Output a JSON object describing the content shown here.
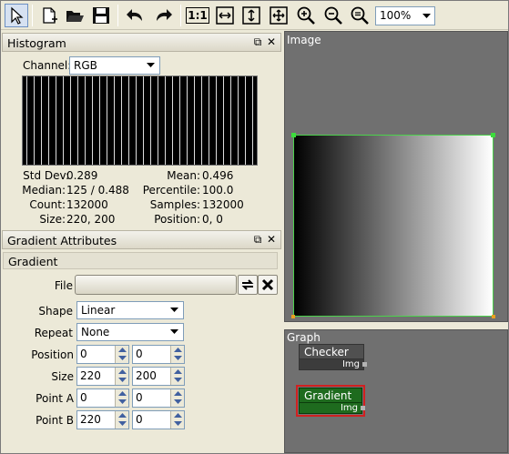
{
  "toolbar": {
    "zoom_value": "100%",
    "icons": [
      "pointer-icon",
      "new-document-icon",
      "open-folder-icon",
      "save-icon",
      "undo-icon",
      "redo-icon",
      "zoom-actual-icon",
      "fit-width-icon",
      "fit-height-icon",
      "fit-window-icon",
      "zoom-in-icon",
      "zoom-out-icon",
      "zoom-reset-icon"
    ],
    "actual_size_label": "1:1"
  },
  "histogram": {
    "title": "Histogram",
    "channel_label": "Channel:",
    "channel_value": "RGB",
    "stats": {
      "std_dev_label": "Std Dev:",
      "std_dev": "0.289",
      "mean_label": "Mean:",
      "mean": "0.496",
      "median_label": "Median:",
      "median": "125 / 0.488",
      "percentile_label": "Percentile:",
      "percentile": "100.0",
      "count_label": "Count:",
      "count": "132000",
      "samples_label": "Samples:",
      "samples": "132000",
      "size_label": "Size:",
      "size": "220, 200",
      "position_label": "Position:",
      "position": "0, 0"
    }
  },
  "gradient_attributes": {
    "title": "Gradient Attributes",
    "section": "Gradient",
    "file_label": "File",
    "file_value": "",
    "shape_label": "Shape",
    "shape_value": "Linear",
    "repeat_label": "Repeat",
    "repeat_value": "None",
    "position_label": "Position",
    "position_x": "0",
    "position_y": "0",
    "size_label": "Size",
    "size_x": "220",
    "size_y": "200",
    "point_a_label": "Point A",
    "point_a_x": "0",
    "point_a_y": "0",
    "point_b_label": "Point B",
    "point_b_x": "220",
    "point_b_y": "0"
  },
  "image_view": {
    "title": "Image"
  },
  "graph": {
    "title": "Graph",
    "nodes": [
      {
        "name": "Checker",
        "port": "Img"
      },
      {
        "name": "Gradient",
        "port": "Img"
      }
    ]
  },
  "colors": {
    "selected_node": "#1e6b1e",
    "selected_border": "#d02020",
    "selection_handle": "#3cdc3c"
  }
}
